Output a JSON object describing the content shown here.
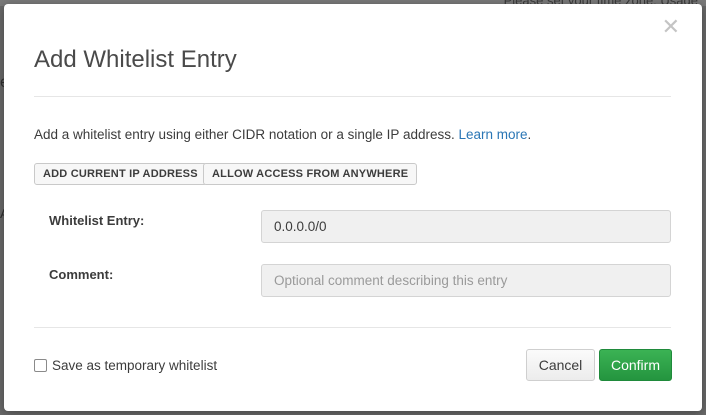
{
  "background": {
    "top_right_fragment": "Please set your time zone.    Usage",
    "left_fragment_1": "e",
    "left_fragment_2": "A"
  },
  "dialog": {
    "title": "Add Whitelist Entry",
    "close_icon": "close-icon",
    "description": "Add a whitelist entry using either CIDR notation or a single IP address.",
    "learn_more_label": "Learn more",
    "period": ".",
    "add_current_ip_label": "ADD CURRENT IP ADDRESS",
    "allow_anywhere_label": "ALLOW ACCESS FROM ANYWHERE",
    "whitelist_entry_label": "Whitelist Entry:",
    "whitelist_entry_value": "0.0.0.0/0",
    "comment_label": "Comment:",
    "comment_value": "",
    "comment_placeholder": "Optional comment describing this entry",
    "temporary_checkbox_label": "Save as temporary whitelist",
    "temporary_checked": false,
    "cancel_label": "Cancel",
    "confirm_label": "Confirm"
  },
  "colors": {
    "accent_link": "#2a76b5",
    "confirm_green": "#2a9d45",
    "backdrop": "#6a6a6a"
  }
}
